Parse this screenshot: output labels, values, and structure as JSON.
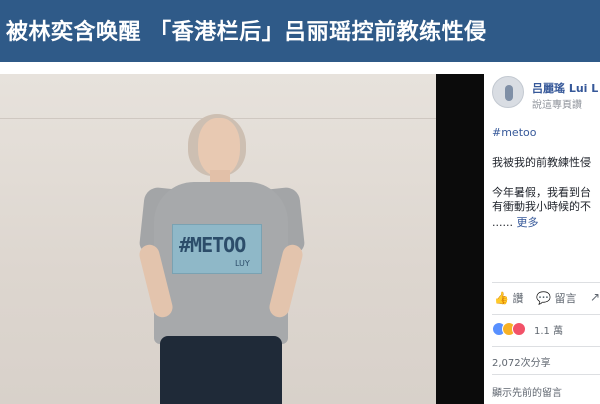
{
  "headline": {
    "text": "被林奕含唤醒 「香港栏后」吕丽瑶控前教练性侵",
    "background_color": "#2f5a88",
    "text_color": "#ffffff"
  },
  "photo": {
    "sign_text": "#METOO",
    "sign_signature": "LUY"
  },
  "facebook_post": {
    "page_name": "吕麗瑤 Lui L",
    "page_subtitle": "說這專頁讚",
    "hashtag": "#metoo",
    "line1": "我被我的前教練性侵",
    "line2": "今年暑假，我看到台",
    "line3": "有衝動我小時候的不",
    "more_prefix": "......",
    "more_link": "更多",
    "actions": {
      "like_label": "讚",
      "comment_label": "留言",
      "share_label": ""
    },
    "reaction_count": "1.1 萬",
    "shares": "2,072次分享",
    "previous_comments": "顯示先前的留言",
    "link_color": "#365899"
  }
}
